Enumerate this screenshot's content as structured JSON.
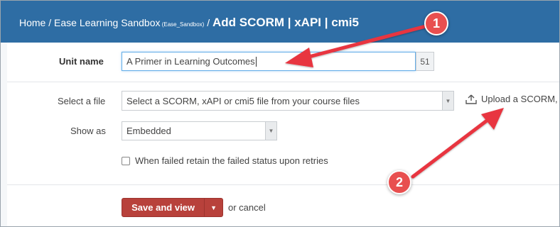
{
  "header": {
    "home": "Home",
    "sep1": " / ",
    "course": "Ease Learning Sandbox",
    "course_code": " (Ease_Sandbox)",
    "sep2": " / ",
    "page_title": "Add SCORM | xAPI | cmi5"
  },
  "form": {
    "unit_name_label": "Unit name",
    "unit_name_value": "A Primer in Learning Outcomes",
    "unit_name_counter": "51",
    "select_file_label": "Select a file",
    "select_file_value": "Select a SCORM, xAPI or cmi5 file from your course files",
    "upload_text": "Upload a SCORM, x",
    "show_as_label": "Show as",
    "show_as_value": "Embedded",
    "retain_failed_label": "When failed retain the failed status upon retries",
    "save_button": "Save and view",
    "or_cancel_prefix": "or ",
    "cancel_link": "cancel"
  },
  "annotations": {
    "badge1": "1",
    "badge2": "2",
    "arrow_color": "#e8353f",
    "badge_color": "#e84f4f"
  },
  "colors": {
    "header_bg": "#2e6da4",
    "save_button_bg": "#b8413b"
  },
  "icons": {
    "upload": "upload-tray-icon",
    "select_caret": "caret-down-icon"
  }
}
